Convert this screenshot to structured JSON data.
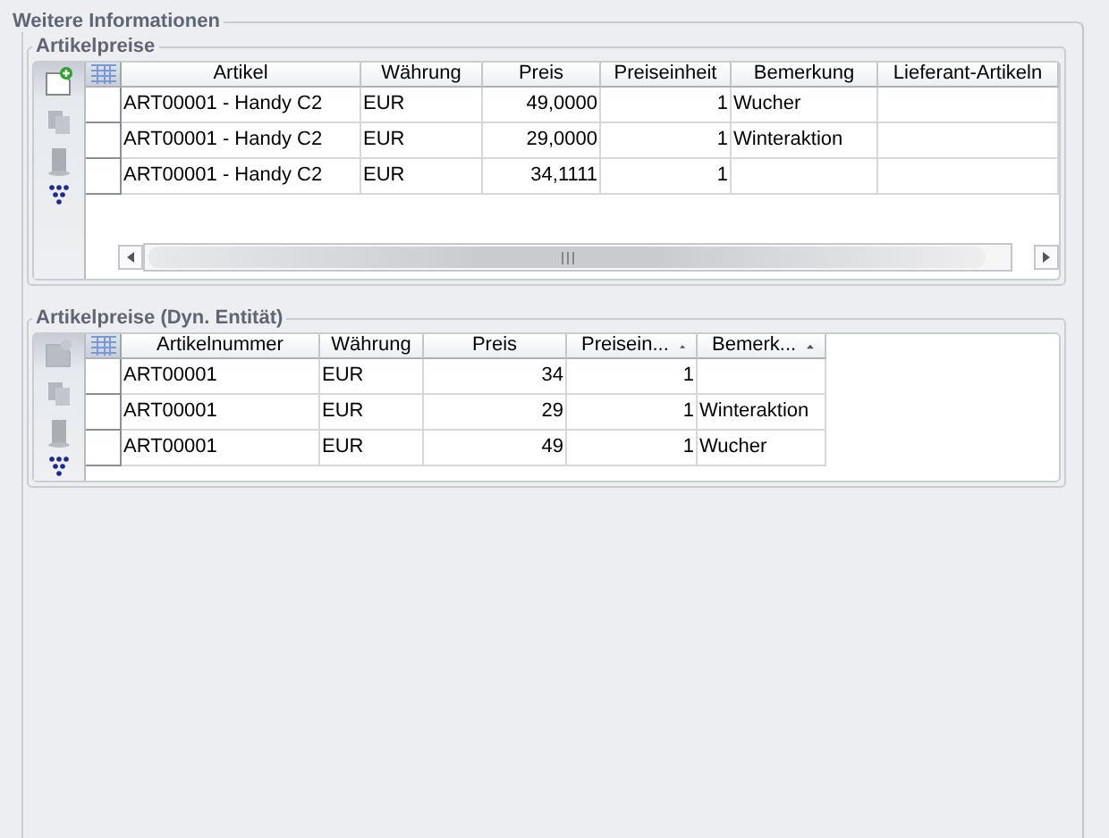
{
  "section": {
    "title": "Weitere Informationen"
  },
  "groups": [
    {
      "title": "Artikelpreise",
      "horizontal_scrollbar": true,
      "toolbar": [
        {
          "kind": "add",
          "disabled": false
        },
        {
          "kind": "copy",
          "disabled": true
        },
        {
          "kind": "delete",
          "disabled": true
        },
        {
          "kind": "filter",
          "disabled": false
        }
      ],
      "columns": [
        {
          "label": "Artikel",
          "sorted": false
        },
        {
          "label": "Währung",
          "sorted": false
        },
        {
          "label": "Preis",
          "sorted": false
        },
        {
          "label": "Preiseinheit",
          "sorted": false
        },
        {
          "label": "Bemerkung",
          "sorted": false
        },
        {
          "label": "Lieferant-Artikeln",
          "sorted": false
        }
      ],
      "rows": [
        [
          "ART00001 - Handy C2",
          "EUR",
          "49,0000",
          "1",
          "Wucher",
          ""
        ],
        [
          "ART00001 - Handy C2",
          "EUR",
          "29,0000",
          "1",
          "Winteraktion",
          ""
        ],
        [
          "ART00001 - Handy C2",
          "EUR",
          "34,1111",
          "1",
          "",
          ""
        ]
      ]
    },
    {
      "title": "Artikelpreise (Dyn. Entität)",
      "horizontal_scrollbar": false,
      "toolbar": [
        {
          "kind": "add",
          "disabled": true
        },
        {
          "kind": "copy",
          "disabled": true
        },
        {
          "kind": "delete",
          "disabled": true
        },
        {
          "kind": "filter",
          "disabled": false
        }
      ],
      "columns": [
        {
          "label": "Artikelnummer",
          "sorted": false
        },
        {
          "label": "Währung",
          "sorted": false
        },
        {
          "label": "Preis",
          "sorted": false
        },
        {
          "label": "Preisein...",
          "sorted": true
        },
        {
          "label": "Bemerk...",
          "sorted": true
        }
      ],
      "rows": [
        [
          "ART00001",
          "EUR",
          "34",
          "1",
          ""
        ],
        [
          "ART00001",
          "EUR",
          "29",
          "1",
          "Winteraktion"
        ],
        [
          "ART00001",
          "EUR",
          "49",
          "1",
          "Wucher"
        ]
      ]
    }
  ]
}
